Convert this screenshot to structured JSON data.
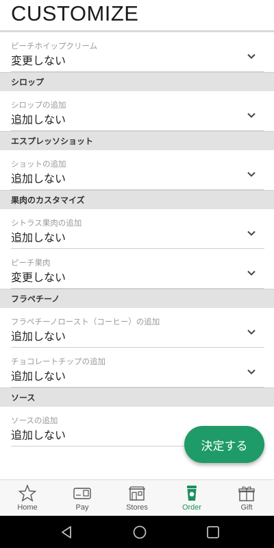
{
  "header": {
    "title": "CUSTOMIZE"
  },
  "top_row": {
    "label": "ピーチホイップクリーム",
    "value": "変更しない"
  },
  "sections": [
    {
      "title": "シロップ",
      "rows": [
        {
          "label": "シロップの追加",
          "value": "追加しない"
        }
      ]
    },
    {
      "title": "エスプレッソショット",
      "rows": [
        {
          "label": "ショットの追加",
          "value": "追加しない"
        }
      ]
    },
    {
      "title": "果肉のカスタマイズ",
      "rows": [
        {
          "label": "シトラス果肉の追加",
          "value": "追加しない"
        },
        {
          "label": "ピーチ果肉",
          "value": "変更しない"
        }
      ]
    },
    {
      "title": "フラペチーノ",
      "rows": [
        {
          "label": "フラペチーノロースト（コーヒー）の追加",
          "value": "追加しない"
        },
        {
          "label": "チョコレートチップの追加",
          "value": "追加しない"
        }
      ]
    },
    {
      "title": "ソース",
      "rows": [
        {
          "label": "ソースの追加",
          "value": "追加しない"
        }
      ]
    }
  ],
  "fab": {
    "label": "決定する"
  },
  "tabs": [
    {
      "label": "Home",
      "icon": "star-icon"
    },
    {
      "label": "Pay",
      "icon": "card-icon"
    },
    {
      "label": "Stores",
      "icon": "store-icon"
    },
    {
      "label": "Order",
      "icon": "cup-icon",
      "active": true
    },
    {
      "label": "Gift",
      "icon": "gift-icon"
    }
  ],
  "colors": {
    "accent": "#1e9b68",
    "section_bg": "#e2e2e2",
    "active_tab": "#1e8f60"
  }
}
